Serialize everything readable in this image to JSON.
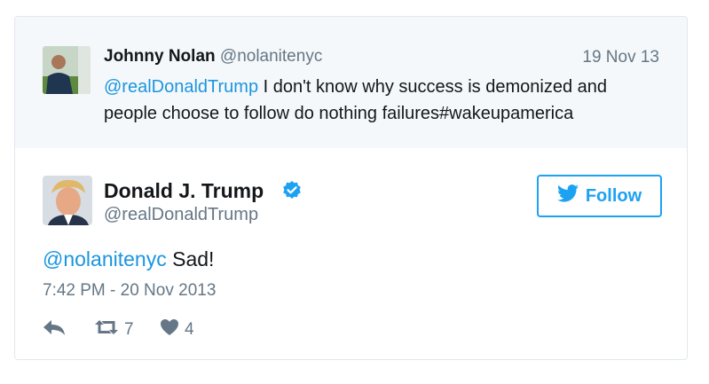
{
  "parent_tweet": {
    "name": "Johnny Nolan",
    "handle": "@nolanitenyc",
    "date": "19 Nov 13",
    "mention": "@realDonaldTrump",
    "text_1": " I don't know why success is demonized and people choose to follow do nothing failures#wakeupamerica"
  },
  "tweet": {
    "name": "Donald J. Trump",
    "handle": "@realDonaldTrump",
    "follow_label": "Follow",
    "mention": "@nolanitenyc",
    "text": " Sad!",
    "timestamp": "7:42 PM - 20 Nov 2013",
    "retweets": "7",
    "likes": "4"
  },
  "colors": {
    "accent": "#1da1f2",
    "link": "#1b95e0",
    "muted": "#657786",
    "parent_bg": "#f5f8fa"
  },
  "icons": [
    "reply-icon",
    "retweet-icon",
    "heart-icon",
    "verified-icon",
    "twitter-bird-icon"
  ]
}
